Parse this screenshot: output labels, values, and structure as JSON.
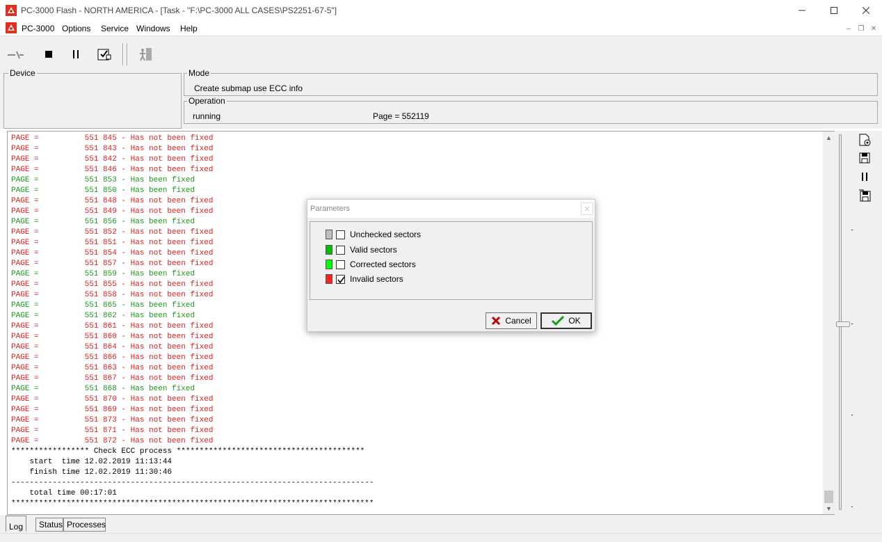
{
  "window": {
    "title": "PC-3000 Flash - NORTH AMERICA - [Task - \"F:\\PC-3000 ALL CASES\\PS2251-67-5\"]"
  },
  "menu": {
    "items": [
      "PC-3000",
      "Options",
      "Service",
      "Windows",
      "Help"
    ]
  },
  "panels": {
    "device_label": "Device",
    "mode_label": "Mode",
    "mode_value": "Create submap use ECC info",
    "operation_label": "Operation",
    "operation_status": "running",
    "operation_page": "Page = 552119"
  },
  "log": {
    "lines": [
      {
        "text": "PAGE =          551 845 - Has not been fixed",
        "color": "red"
      },
      {
        "text": "PAGE =          551 843 - Has not been fixed",
        "color": "red"
      },
      {
        "text": "PAGE =          551 842 - Has not been fixed",
        "color": "red"
      },
      {
        "text": "PAGE =          551 846 - Has not been fixed",
        "color": "red"
      },
      {
        "text": "PAGE =          551 853 - Has been fixed",
        "color": "green"
      },
      {
        "text": "PAGE =          551 850 - Has been fixed",
        "color": "green"
      },
      {
        "text": "PAGE =          551 848 - Has not been fixed",
        "color": "red"
      },
      {
        "text": "PAGE =          551 849 - Has not been fixed",
        "color": "red"
      },
      {
        "text": "PAGE =          551 856 - Has been fixed",
        "color": "green"
      },
      {
        "text": "PAGE =          551 852 - Has not been fixed",
        "color": "red"
      },
      {
        "text": "PAGE =          551 851 - Has not been fixed",
        "color": "red"
      },
      {
        "text": "PAGE =          551 854 - Has not been fixed",
        "color": "red"
      },
      {
        "text": "PAGE =          551 857 - Has not been fixed",
        "color": "red"
      },
      {
        "text": "PAGE =          551 859 - Has been fixed",
        "color": "green"
      },
      {
        "text": "PAGE =          551 855 - Has not been fixed",
        "color": "red"
      },
      {
        "text": "PAGE =          551 858 - Has not been fixed",
        "color": "red"
      },
      {
        "text": "PAGE =          551 865 - Has been fixed",
        "color": "green"
      },
      {
        "text": "PAGE =          551 862 - Has been fixed",
        "color": "green"
      },
      {
        "text": "PAGE =          551 861 - Has not been fixed",
        "color": "red"
      },
      {
        "text": "PAGE =          551 860 - Has not been fixed",
        "color": "red"
      },
      {
        "text": "PAGE =          551 864 - Has not been fixed",
        "color": "red"
      },
      {
        "text": "PAGE =          551 866 - Has not been fixed",
        "color": "red"
      },
      {
        "text": "PAGE =          551 863 - Has not been fixed",
        "color": "red"
      },
      {
        "text": "PAGE =          551 867 - Has not been fixed",
        "color": "red"
      },
      {
        "text": "PAGE =          551 868 - Has been fixed",
        "color": "green"
      },
      {
        "text": "PAGE =          551 870 - Has not been fixed",
        "color": "red"
      },
      {
        "text": "PAGE =          551 869 - Has not been fixed",
        "color": "red"
      },
      {
        "text": "PAGE =          551 873 - Has not been fixed",
        "color": "red"
      },
      {
        "text": "PAGE =          551 871 - Has not been fixed",
        "color": "red"
      },
      {
        "text": "PAGE =          551 872 - Has not been fixed",
        "color": "red"
      },
      {
        "text": "***************** Check ECC process *****************************************",
        "color": "black"
      },
      {
        "text": "    start  time 12.02.2019 11:13:44",
        "color": "black"
      },
      {
        "text": "    finish time 12.02.2019 11:30:46",
        "color": "black"
      },
      {
        "text": "-------------------------------------------------------------------------------",
        "color": "black"
      },
      {
        "text": "    total time 00:17:01",
        "color": "black"
      },
      {
        "text": "*******************************************************************************",
        "color": "black"
      }
    ]
  },
  "tabs": [
    "Log",
    "Status",
    "Processes"
  ],
  "dialog": {
    "title": "Parameters",
    "items": [
      {
        "label": "Unchecked sectors",
        "color": "#c0c0c0",
        "checked": false
      },
      {
        "label": "Valid sectors",
        "color": "#00c000",
        "checked": false
      },
      {
        "label": "Corrected sectors",
        "color": "#00ff00",
        "checked": false
      },
      {
        "label": "Invalid sectors",
        "color": "#ff2020",
        "checked": true
      }
    ],
    "cancel_label": "Cancel",
    "ok_label": "OK"
  },
  "colors": {
    "log_error": "#e02020",
    "log_ok": "#1a9a1a"
  }
}
